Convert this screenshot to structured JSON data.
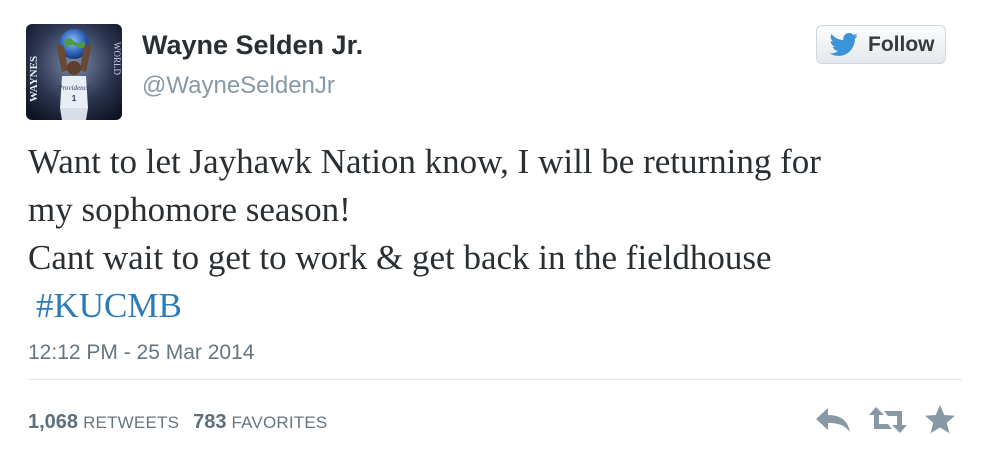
{
  "tweet": {
    "author": {
      "name": "Wayne Selden Jr.",
      "handle": "@WayneSeldenJr",
      "avatar_text_left": "WAYNES",
      "avatar_text_right": "WORLD"
    },
    "follow_button": {
      "label": "Follow",
      "icon": "twitter-bird-icon"
    },
    "text_lines": [
      "Want to let Jayhawk Nation know, I will be returning for",
      "my sophomore season!",
      "Cant wait to get to work & get back in the fieldhouse"
    ],
    "hashtag": "#KUCMB",
    "timestamp": "12:12 PM - 25 Mar 2014",
    "stats": {
      "retweets_count": "1,068",
      "retweets_label": "RETWEETS",
      "favorites_count": "783",
      "favorites_label": "FAVORITES"
    },
    "actions": {
      "reply_icon": "reply-icon",
      "retweet_icon": "retweet-icon",
      "favorite_icon": "star-icon"
    },
    "colors": {
      "name": "#292f33",
      "handle": "#8899a6",
      "hashtag": "#2b7bb9",
      "twitter_blue": "#3b94d9",
      "action_icons": "#8899a6"
    }
  }
}
